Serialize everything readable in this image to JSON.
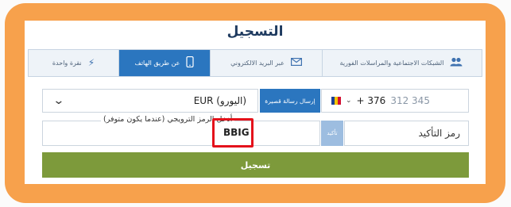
{
  "title": "التسجيل",
  "tabs": [
    {
      "label": "نقرة واحدة",
      "icon": "lightning-icon",
      "active": false
    },
    {
      "label": "عن طريق الهاتف",
      "icon": "phone-icon",
      "active": true
    },
    {
      "label": "عبر البريد الالكتروني",
      "icon": "envelope-icon",
      "active": false
    },
    {
      "label": "الشبكات الاجتماعية والمراسلات الفورية",
      "icon": "users-icon",
      "active": false
    }
  ],
  "currency": {
    "value": "EUR (اليورو)"
  },
  "sms_button": "إرسال رسالة قصيرة",
  "phone": {
    "code": "+ 376",
    "placeholder": "312 345"
  },
  "promo": {
    "label": "أدخل الرمز الترويجي (عندما يكون متوفر)",
    "value": "BBIG"
  },
  "confirm_button": "تأكيد",
  "confirmation_code": {
    "placeholder": "رمز التأكيد"
  },
  "submit": "تسجيل",
  "colors": {
    "accent": "#2b76bf",
    "submit": "#7d9a3b",
    "frame": "#f7a14c",
    "highlight": "#e4121b"
  }
}
